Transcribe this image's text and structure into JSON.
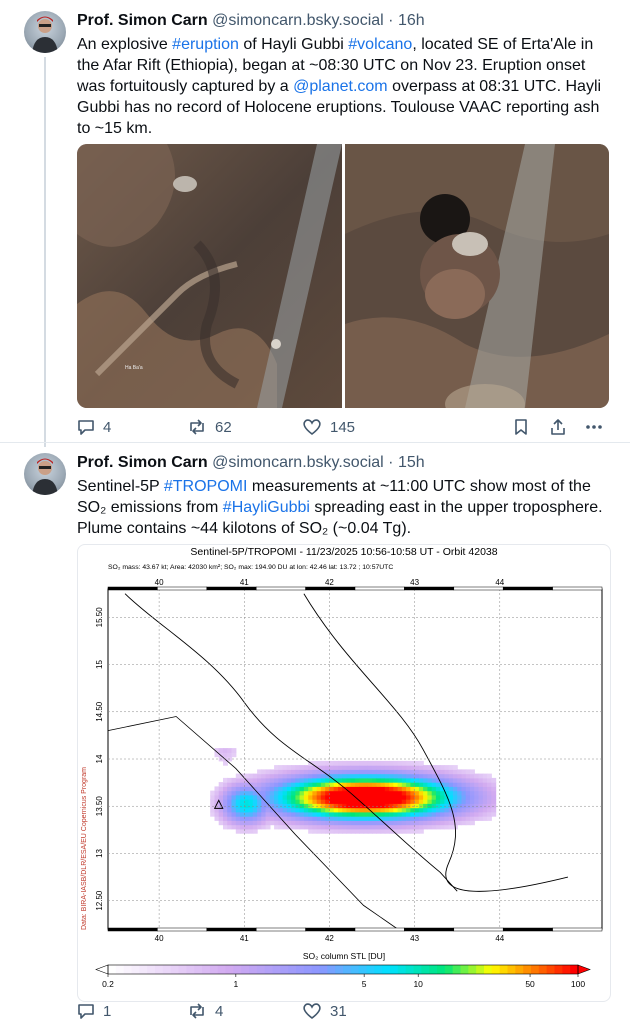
{
  "posts": [
    {
      "author": "Prof. Simon Carn",
      "handle": "@simoncarn.bsky.social",
      "time": "16h",
      "text_parts": {
        "p1": "An explosive ",
        "tag1": "#eruption",
        "p2": " of Hayli Gubbi ",
        "tag2": "#volcano",
        "p3": ", located SE of Erta'Ale in the Afar Rift (Ethiopia), began at ~08:30 UTC on Nov 23. Eruption onset was fortuitously captured by a ",
        "link1": "@planet.com",
        "p4": " overpass at 08:31 UTC. Hayli Gubbi has no record of Holocene eruptions. Toulouse VAAC reporting ash to ~15 km."
      },
      "replies": "4",
      "reposts": "62",
      "likes": "145"
    },
    {
      "author": "Prof. Simon Carn",
      "handle": "@simoncarn.bsky.social",
      "time": "15h",
      "text_parts": {
        "p1": "Sentinel-5P ",
        "tag1": "#TROPOMI",
        "p2": " measurements at ~11:00 UTC show most of the SO₂ emissions from ",
        "tag2": "#HayliGubbi",
        "p3": " spreading east in the upper troposphere. Plume contains ~44 kilotons of SO₂ (~0.04 Tg)."
      },
      "replies": "1",
      "reposts": "4",
      "likes": "31"
    }
  ],
  "small_label": "Ha Ba'a",
  "chart_data": {
    "type": "heatmap",
    "title": "Sentinel-5P/TROPOMI - 11/23/2025 10:56-10:58 UT - Orbit 42038",
    "subtitle": "SO₂ mass: 43.67 kt; Area: 42030 km²; SO₂ max: 194.90 DU at lon: 42.46 lat: 13.72 ; 10:57UTC",
    "xlabel": "SO₂ column STL [DU]",
    "credit": "Data: BIRA-IASB/DLR/ESA/EU Copernicus Program",
    "x_ticks": [
      "40",
      "41",
      "42",
      "43",
      "44"
    ],
    "y_ticks": [
      "12.50",
      "13",
      "13.50",
      "14",
      "14.50",
      "15",
      "15.50"
    ],
    "xlim": [
      39.4,
      45.2
    ],
    "ylim": [
      12.2,
      15.8
    ],
    "colorbar_ticks": [
      "0.2",
      "1",
      "5",
      "10",
      "50",
      "100"
    ],
    "colors": {
      "low": "#ffffff",
      "mid1": "#c9a6f2",
      "mid2": "#00e1ff",
      "mid3": "#ffff00",
      "high": "#ff0000"
    }
  },
  "colors": {
    "accent": "#1a73e8",
    "muted": "#42576c"
  }
}
